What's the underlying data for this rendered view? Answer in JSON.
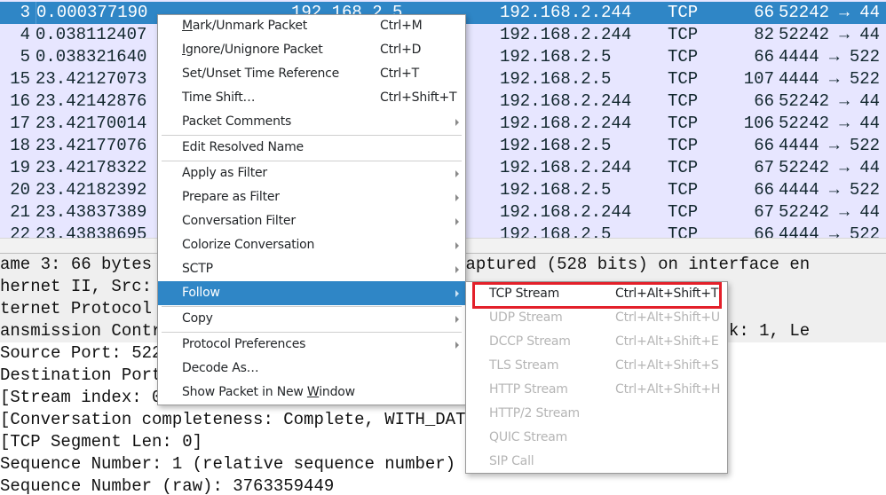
{
  "packet_list": {
    "rows": [
      {
        "no": "3",
        "time": "0.000377190",
        "source": "192.168.2.5",
        "destination": "192.168.2.244",
        "protocol": "TCP",
        "length": "66",
        "info": "52242 → 44",
        "selected": true
      },
      {
        "no": "4",
        "time": "0.038112407",
        "source": "",
        "destination": "192.168.2.244",
        "protocol": "TCP",
        "length": "82",
        "info": "52242 → 44"
      },
      {
        "no": "5",
        "time": "0.038321640",
        "source": "",
        "destination": "192.168.2.5",
        "protocol": "TCP",
        "length": "66",
        "info": "4444 → 522"
      },
      {
        "no": "15",
        "time": "23.42127073",
        "source": "",
        "destination": "192.168.2.5",
        "protocol": "TCP",
        "length": "107",
        "info": "4444 → 522"
      },
      {
        "no": "16",
        "time": "23.42142876",
        "source": "",
        "destination": "192.168.2.244",
        "protocol": "TCP",
        "length": "66",
        "info": "52242 → 44"
      },
      {
        "no": "17",
        "time": "23.42170014",
        "source": "",
        "destination": "192.168.2.244",
        "protocol": "TCP",
        "length": "106",
        "info": "52242 → 44"
      },
      {
        "no": "18",
        "time": "23.42177076",
        "source": "",
        "destination": "192.168.2.5",
        "protocol": "TCP",
        "length": "66",
        "info": "4444 → 522"
      },
      {
        "no": "19",
        "time": "23.42178322",
        "source": "",
        "destination": "192.168.2.244",
        "protocol": "TCP",
        "length": "67",
        "info": "52242 → 44"
      },
      {
        "no": "20",
        "time": "23.42182392",
        "source": "",
        "destination": "192.168.2.5",
        "protocol": "TCP",
        "length": "66",
        "info": "4444 → 522"
      },
      {
        "no": "21",
        "time": "23.43837389",
        "source": "",
        "destination": "192.168.2.244",
        "protocol": "TCP",
        "length": "67",
        "info": "52242 → 44"
      },
      {
        "no": "22",
        "time": "23.43838695",
        "source": "",
        "destination": "192.168.2.5",
        "protocol": "TCP",
        "length": "66",
        "info": "4444 → 522"
      }
    ]
  },
  "details": {
    "lines": [
      "ame 3: 66 bytes on wire (528 bits), 66 bytes captured (528 bits) on interface en",
      "hernet II, Src: ..., Dst: ...:82:f5:94 (00:0c",
      "ternet Protocol Version 4, Src: 192.168.2.5, Dst: 192.168.2.244",
      "ansmission Control Protocol, Src Port: 52242, Dst Port: 4444, Seq: 1, Ack: 1, Le",
      "Source Port: 52242",
      "Destination Port: 4444",
      "[Stream index: 0]",
      "[Conversation completeness: Complete, WITH_DATA (31)]",
      "[TCP Segment Len: 0]",
      "Sequence Number: 1    (relative sequence number)",
      "Sequence Number (raw): 3763359449"
    ]
  },
  "context_menu": {
    "items": [
      {
        "pre": "",
        "u": "M",
        "post": "ark/Unmark Packet",
        "shortcut": "Ctrl+M"
      },
      {
        "pre": "",
        "u": "I",
        "post": "gnore/Unignore Packet",
        "shortcut": "Ctrl+D"
      },
      {
        "pre": "Set/Unset Time Reference",
        "u": "",
        "post": "",
        "shortcut": "Ctrl+T"
      },
      {
        "pre": "Time Shift…",
        "u": "",
        "post": "",
        "shortcut": "Ctrl+Shift+T"
      },
      {
        "pre": "Packet Comments",
        "u": "",
        "post": "",
        "submenu": true
      },
      {
        "pre": "Edit Resolved Name",
        "u": "",
        "post": ""
      },
      {
        "pre": "Apply as Filter",
        "u": "",
        "post": "",
        "submenu": true
      },
      {
        "pre": "Prepare as Filter",
        "u": "",
        "post": "",
        "submenu": true
      },
      {
        "pre": "Conversation Filter",
        "u": "",
        "post": "",
        "submenu": true
      },
      {
        "pre": "Colorize Conversation",
        "u": "",
        "post": "",
        "submenu": true
      },
      {
        "pre": "SCTP",
        "u": "",
        "post": "",
        "submenu": true
      },
      {
        "pre": "Follow",
        "u": "",
        "post": "",
        "submenu": true,
        "active": true
      },
      {
        "pre": "Copy",
        "u": "",
        "post": "",
        "submenu": true
      },
      {
        "pre": "Protocol Preferences",
        "u": "",
        "post": "",
        "submenu": true
      },
      {
        "pre": "Decode As…",
        "u": "",
        "post": ""
      },
      {
        "pre": "Show Packet in New ",
        "u": "W",
        "post": "indow"
      }
    ]
  },
  "follow_submenu": {
    "items": [
      {
        "label": "TCP Stream",
        "shortcut": "Ctrl+Alt+Shift+T",
        "enabled": true
      },
      {
        "label": "UDP Stream",
        "shortcut": "Ctrl+Alt+Shift+U",
        "enabled": false
      },
      {
        "label": "DCCP Stream",
        "shortcut": "Ctrl+Alt+Shift+E",
        "enabled": false
      },
      {
        "label": "TLS Stream",
        "shortcut": "Ctrl+Alt+Shift+S",
        "enabled": false
      },
      {
        "label": "HTTP Stream",
        "shortcut": "Ctrl+Alt+Shift+H",
        "enabled": false
      },
      {
        "label": "HTTP/2 Stream",
        "shortcut": "",
        "enabled": false
      },
      {
        "label": "QUIC Stream",
        "shortcut": "",
        "enabled": false
      },
      {
        "label": "SIP Call",
        "shortcut": "",
        "enabled": false
      }
    ]
  },
  "colors": {
    "selection": "#2f86c6",
    "packet_row_bg": "#e7e6ff",
    "highlight_box": "#e3202a"
  }
}
